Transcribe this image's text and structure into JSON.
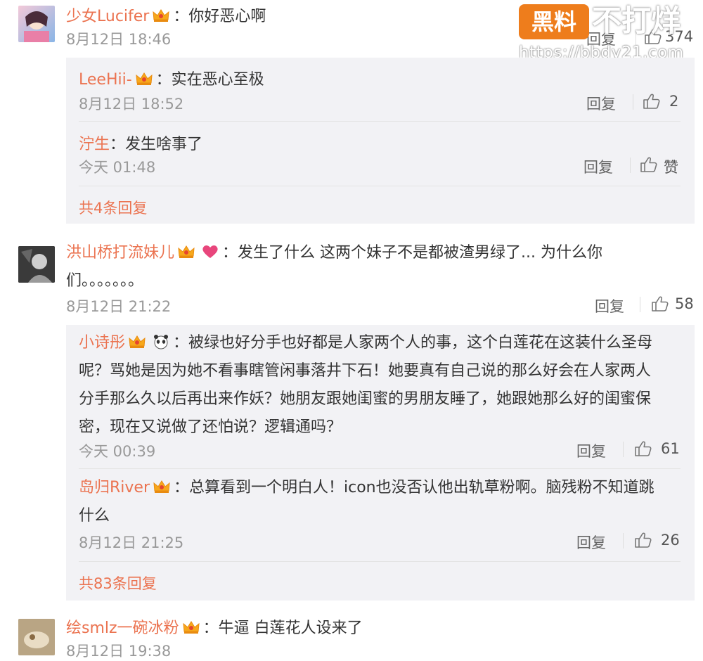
{
  "watermark": {
    "logo_text": "黑料",
    "title": "不打烊",
    "url": "https://bbdy21.com"
  },
  "comments": [
    {
      "user": "少女Lucifer",
      "text": "你好恶心啊",
      "time": "8月12日 18:46",
      "reply_label": "回复",
      "likes": "374",
      "replies": [
        {
          "user": "LeeHii-",
          "text": "实在恶心至极",
          "time": "8月12日 18:52",
          "reply_label": "回复",
          "likes": "2"
        },
        {
          "user": "泞生",
          "text": "发生啥事了",
          "time": "今天 01:48",
          "reply_label": "回复",
          "likes": "赞"
        }
      ],
      "more_replies": "共4条回复"
    },
    {
      "user": "洪山桥打流妹儿",
      "text_line1": "发生了什么 这两个妹子不是都被渣男绿了... 为什么你",
      "text_line2": "们。。。。。。。",
      "time": "8月12日 21:22",
      "reply_label": "回复",
      "likes": "58",
      "replies": [
        {
          "user": "小诗彤",
          "text_line1": "被绿也好分手也好都是人家两个人的事，这个白莲花在这装什么圣母",
          "text_line2": "呢？骂她是因为她不看事瞎管闲事落井下石！她要真有自己说的那么好会在人家两人",
          "text_line3": "分手那么久以后再出来作妖？她朋友跟她闺蜜的男朋友睡了，她跟她那么好的闺蜜保",
          "text_line4": "密，现在又说做了还怕说？逻辑通吗？",
          "time": "今天 00:39",
          "reply_label": "回复",
          "likes": "61"
        },
        {
          "user": "岛归River",
          "text_line1": "总算看到一个明白人！icon也没否认他出轨草粉啊。脑残粉不知道跳",
          "text_line2": "什么",
          "time": "8月12日 21:25",
          "reply_label": "回复",
          "likes": "26"
        }
      ],
      "more_replies": "共83条回复"
    },
    {
      "user": "绘smlz一碗冰粉",
      "text": "牛逼 白莲花人设来了",
      "time": "8月12日 19:38"
    }
  ],
  "colon": "："
}
